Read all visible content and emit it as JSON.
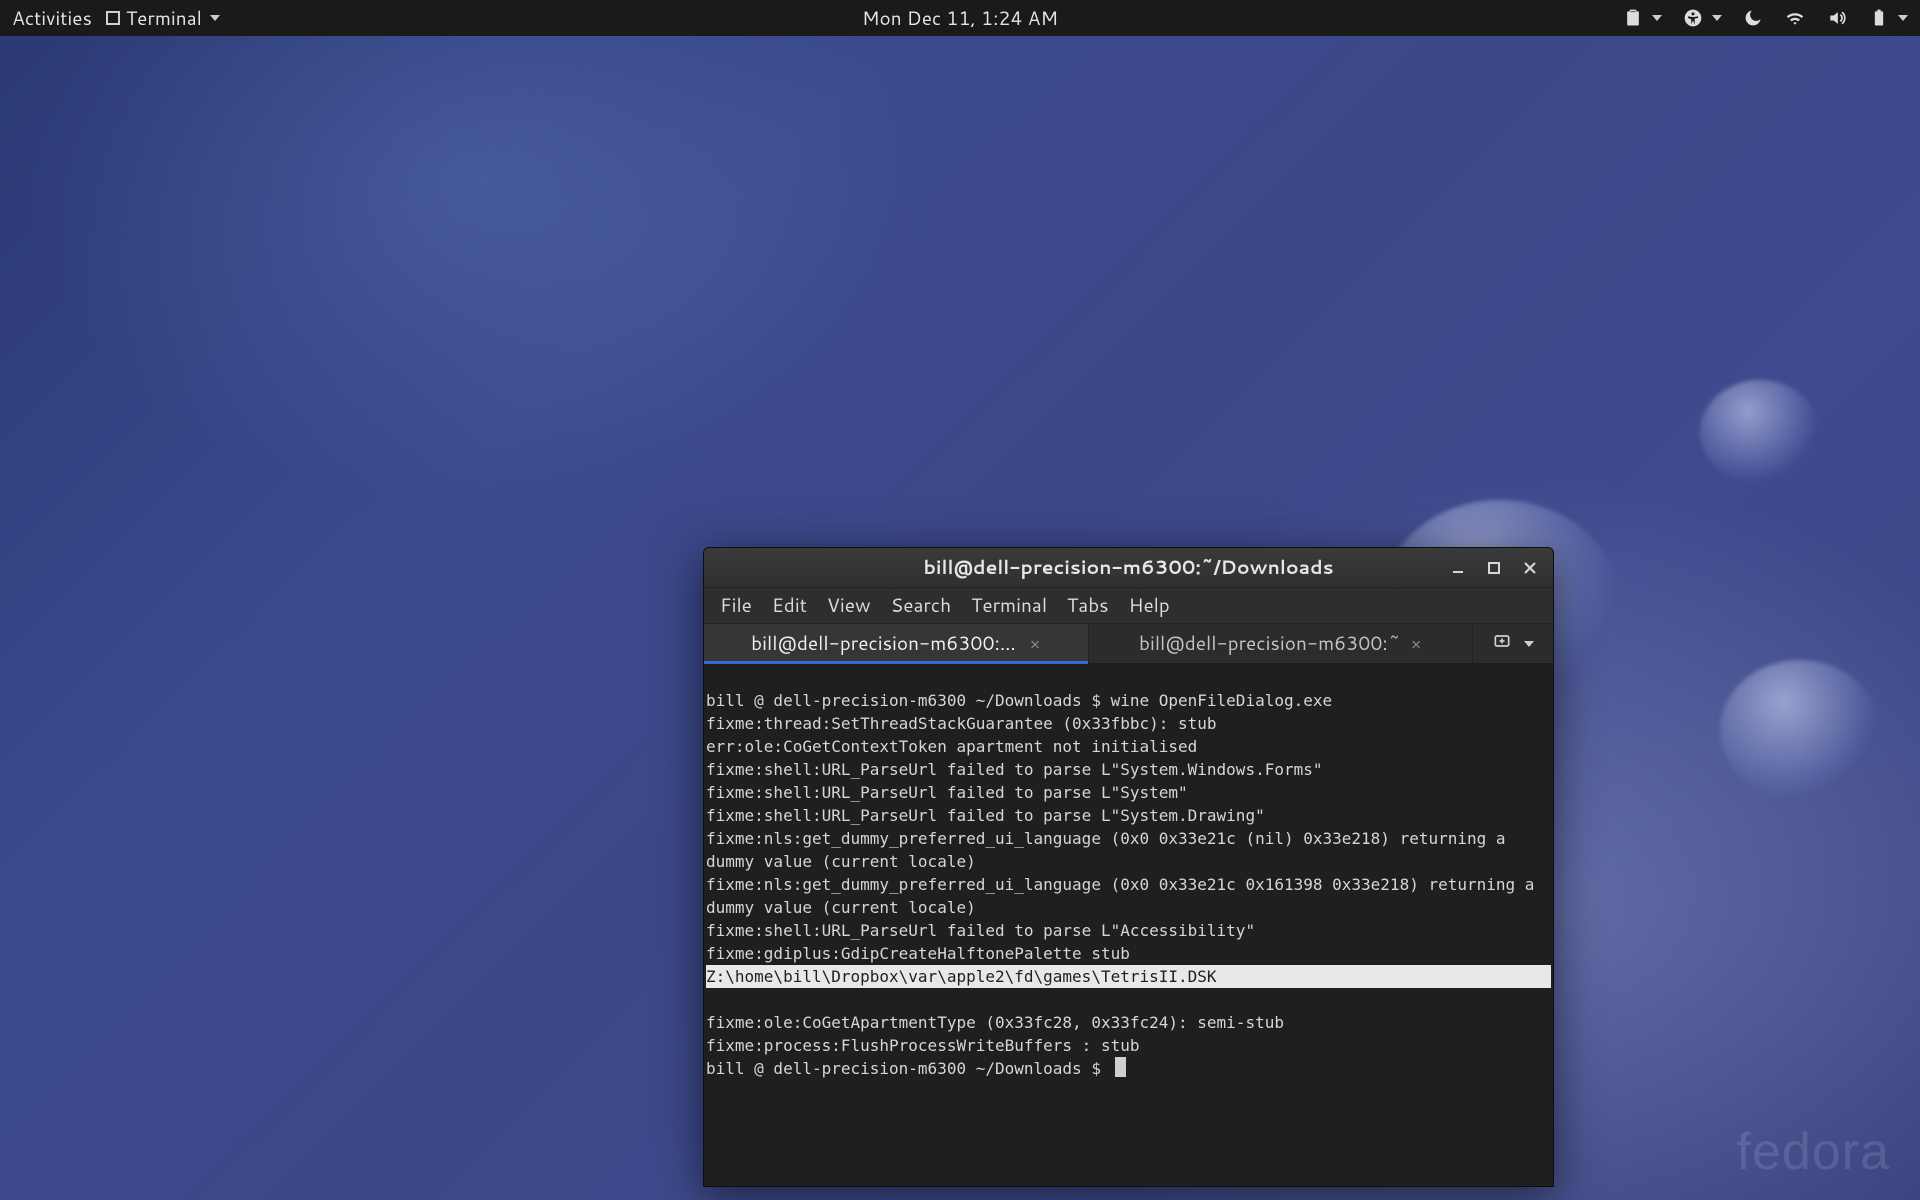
{
  "topbar": {
    "activities": "Activities",
    "app_name": "Terminal",
    "datetime": "Mon Dec 11,  1:24 AM"
  },
  "watermark": "fedora",
  "terminal": {
    "title": "bill@dell-precision-m6300:~/Downloads",
    "menus": [
      "File",
      "Edit",
      "View",
      "Search",
      "Terminal",
      "Tabs",
      "Help"
    ],
    "tabs": [
      {
        "label": "bill@dell-precision-m6300:~/Down…",
        "active": true
      },
      {
        "label": "bill@dell-precision-m6300:~",
        "active": false
      }
    ],
    "lines": [
      "bill @ dell-precision-m6300 ~/Downloads $ wine OpenFileDialog.exe",
      "fixme:thread:SetThreadStackGuarantee (0x33fbbc): stub",
      "err:ole:CoGetContextToken apartment not initialised",
      "fixme:shell:URL_ParseUrl failed to parse L\"System.Windows.Forms\"",
      "fixme:shell:URL_ParseUrl failed to parse L\"System\"",
      "fixme:shell:URL_ParseUrl failed to parse L\"System.Drawing\"",
      "fixme:nls:get_dummy_preferred_ui_language (0x0 0x33e21c (nil) 0x33e218) returning a dummy value (current locale)",
      "fixme:nls:get_dummy_preferred_ui_language (0x0 0x33e21c 0x161398 0x33e218) returning a dummy value (current locale)",
      "fixme:shell:URL_ParseUrl failed to parse L\"Accessibility\"",
      "fixme:gdiplus:GdipCreateHalftonePalette stub"
    ],
    "highlighted": "Z:\\home\\bill\\Dropbox\\var\\apple2\\fd\\games\\TetrisII.DSK",
    "lines_after": [
      "fixme:ole:CoGetApartmentType (0x33fc28, 0x33fc24): semi-stub",
      "fixme:process:FlushProcessWriteBuffers : stub"
    ],
    "prompt_final": "bill @ dell-precision-m6300 ~/Downloads $ "
  }
}
